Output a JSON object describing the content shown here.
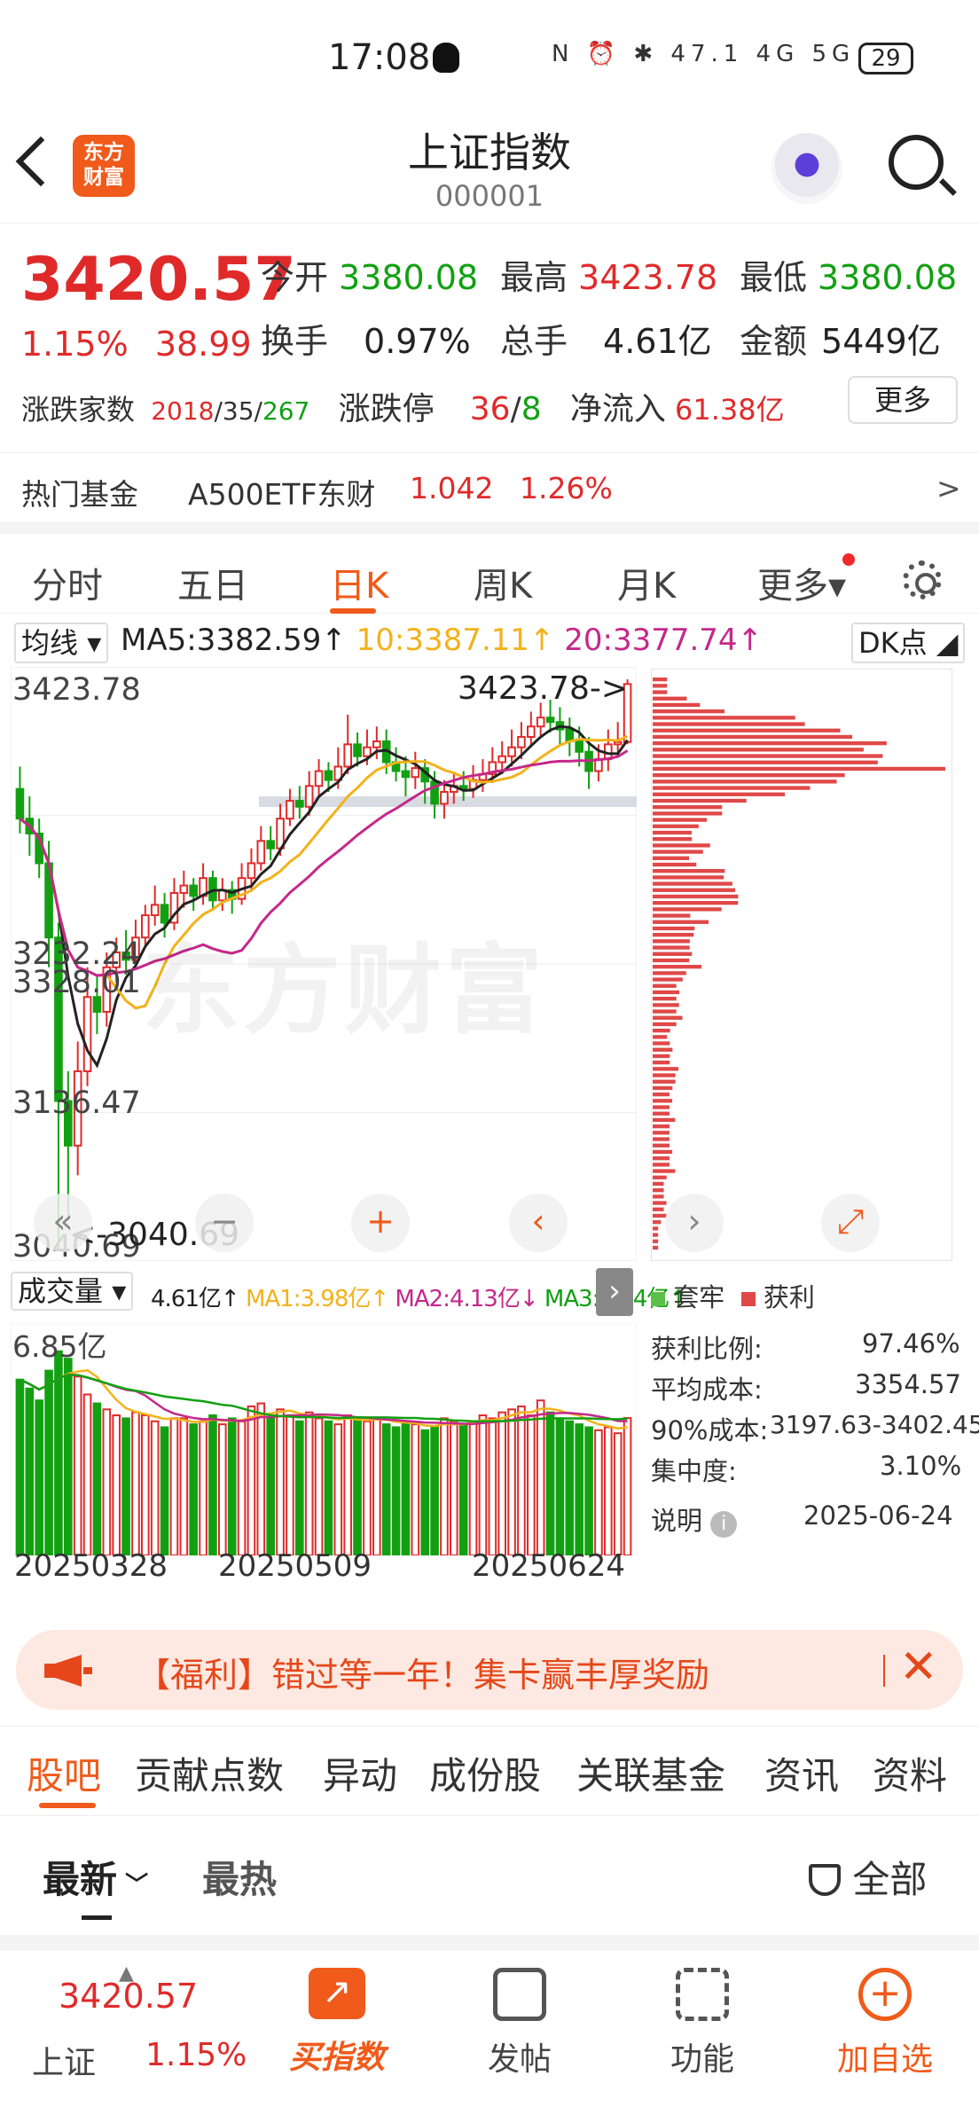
{
  "status": {
    "time": "17:08",
    "icons": "N ⏰ ✱ 47.1 4G 5G",
    "battery": "29"
  },
  "header": {
    "title": "上证指数",
    "code": "000001",
    "logo": "东方\n财富"
  },
  "quote": {
    "price": "3420.57",
    "change_pct": "1.15%",
    "change": "38.99",
    "open_label": "今开",
    "open": "3380.08",
    "high_label": "最高",
    "high": "3423.78",
    "low_label": "最低",
    "low": "3380.08",
    "turnover_label": "换手",
    "turnover": "0.97%",
    "volume_label": "总手",
    "volume": "4.61亿",
    "amount_label": "金额",
    "amount": "5449亿",
    "updown_label": "涨跌家数",
    "up": "2018",
    "flat": "35",
    "down": "267",
    "limit_label": "涨跌停",
    "limit_up": "36",
    "limit_down": "8",
    "inflow_label": "净流入",
    "inflow": "61.38亿",
    "more_label": "更多",
    "hot_fund_label": "热门基金",
    "hot_fund_name": "A500ETF东财",
    "hot_fund_price": "1.042",
    "hot_fund_pct": "1.26%",
    "hot_fund_arrow": ">"
  },
  "chart_tabs": [
    "分时",
    "五日",
    "日K",
    "周K",
    "月K",
    "更多▾"
  ],
  "chart": {
    "ma_selector": "均线",
    "ma5": "MA5:3382.59↑",
    "ma10": "10:3387.11↑",
    "ma20": "20:3377.74↑",
    "dk_label": "DK点",
    "price_labels": [
      "3423.78",
      "3328.01",
      "3232.24",
      "3136.47",
      "3040.69"
    ],
    "high_marker": "3423.78->",
    "low_marker": "<-3040.69",
    "watermark": "东方财富",
    "vol_selector": "成交量",
    "vol_value": "4.61亿↑",
    "vol_ma1": "MA1:3.98亿↑",
    "vol_ma2": "MA2:4.13亿↓",
    "vol_ma3": "MA3:4.04亿↑",
    "vol_max": "6.85亿",
    "dates": [
      "20250328",
      "20250509",
      "20250624"
    ],
    "colors": {
      "up": "#e02a2a",
      "down": "#12a012",
      "ma5": "#222222",
      "ma10": "#f2b21b",
      "ma20": "#c5288a"
    }
  },
  "cost": {
    "legend_locked": "套牢",
    "legend_profit": "获利",
    "profit_ratio_label": "获利比例:",
    "profit_ratio": "97.46%",
    "avg_cost_label": "平均成本:",
    "avg_cost": "3354.57",
    "cost90_label": "90%成本:",
    "cost90": "3197.63-3402.45",
    "concentration_label": "集中度:",
    "concentration": "3.10%",
    "note_label": "说明",
    "date": "2025-06-24"
  },
  "banner": {
    "text": "【福利】错过等一年！集卡赢丰厚奖励"
  },
  "bottom_tabs": [
    "股吧",
    "贡献点数",
    "异动",
    "成份股",
    "关联基金",
    "资讯",
    "资料"
  ],
  "sorts": {
    "latest": "最新",
    "hot": "最热",
    "filter": "全部"
  },
  "bottom_nav": {
    "index_price": "3420.57",
    "index_name": "上证",
    "index_pct": "1.15%",
    "buy": "买指数",
    "post": "发帖",
    "func": "功能",
    "add": "加自选"
  },
  "chart_data": {
    "type": "candlestick",
    "ylim": [
      3040.69,
      3423.78
    ],
    "xlabels": [
      "20250328",
      "20250509",
      "20250624"
    ],
    "candles": [
      [
        3350,
        3330,
        3365,
        3320
      ],
      [
        3330,
        3320,
        3345,
        3305
      ],
      [
        3320,
        3300,
        3330,
        3290
      ],
      [
        3300,
        3250,
        3315,
        3230
      ],
      [
        3250,
        3140,
        3260,
        3040.69
      ],
      [
        3140,
        3110,
        3160,
        3060
      ],
      [
        3110,
        3160,
        3180,
        3090
      ],
      [
        3160,
        3210,
        3230,
        3150
      ],
      [
        3210,
        3200,
        3225,
        3185
      ],
      [
        3200,
        3230,
        3240,
        3190
      ],
      [
        3230,
        3240,
        3250,
        3220
      ],
      [
        3240,
        3235,
        3255,
        3225
      ],
      [
        3235,
        3250,
        3262,
        3230
      ],
      [
        3250,
        3265,
        3272,
        3245
      ],
      [
        3265,
        3272,
        3285,
        3258
      ],
      [
        3272,
        3260,
        3280,
        3250
      ],
      [
        3260,
        3280,
        3290,
        3255
      ],
      [
        3280,
        3285,
        3295,
        3270
      ],
      [
        3285,
        3278,
        3290,
        3268
      ],
      [
        3278,
        3290,
        3300,
        3272
      ],
      [
        3290,
        3275,
        3295,
        3268
      ],
      [
        3275,
        3282,
        3290,
        3268
      ],
      [
        3282,
        3276,
        3288,
        3266
      ],
      [
        3276,
        3290,
        3300,
        3272
      ],
      [
        3290,
        3300,
        3310,
        3282
      ],
      [
        3300,
        3315,
        3325,
        3295
      ],
      [
        3315,
        3310,
        3325,
        3302
      ],
      [
        3310,
        3330,
        3340,
        3305
      ],
      [
        3330,
        3342,
        3350,
        3325
      ],
      [
        3342,
        3338,
        3352,
        3330
      ],
      [
        3338,
        3352,
        3362,
        3332
      ],
      [
        3352,
        3362,
        3370,
        3345
      ],
      [
        3362,
        3356,
        3368,
        3348
      ],
      [
        3356,
        3365,
        3378,
        3350
      ],
      [
        3365,
        3380,
        3400,
        3360
      ],
      [
        3380,
        3372,
        3388,
        3365
      ],
      [
        3372,
        3378,
        3390,
        3366
      ],
      [
        3378,
        3382,
        3392,
        3370
      ],
      [
        3382,
        3368,
        3390,
        3360
      ],
      [
        3368,
        3362,
        3378,
        3355
      ],
      [
        3362,
        3358,
        3372,
        3345
      ],
      [
        3358,
        3364,
        3375,
        3350
      ],
      [
        3364,
        3355,
        3370,
        3340
      ],
      [
        3355,
        3340,
        3362,
        3330
      ],
      [
        3340,
        3348,
        3356,
        3330
      ],
      [
        3348,
        3352,
        3360,
        3340
      ],
      [
        3352,
        3350,
        3362,
        3342
      ],
      [
        3350,
        3356,
        3366,
        3344
      ],
      [
        3356,
        3360,
        3370,
        3348
      ],
      [
        3360,
        3368,
        3378,
        3354
      ],
      [
        3368,
        3372,
        3382,
        3360
      ],
      [
        3372,
        3378,
        3390,
        3365
      ],
      [
        3378,
        3385,
        3395,
        3370
      ],
      [
        3385,
        3392,
        3402,
        3378
      ],
      [
        3392,
        3398,
        3408,
        3385
      ],
      [
        3398,
        3395,
        3410,
        3388
      ],
      [
        3395,
        3390,
        3405,
        3380
      ],
      [
        3390,
        3382,
        3398,
        3372
      ],
      [
        3382,
        3375,
        3392,
        3365
      ],
      [
        3375,
        3362,
        3385,
        3350
      ],
      [
        3362,
        3370,
        3380,
        3355
      ],
      [
        3370,
        3380,
        3390,
        3362
      ],
      [
        3380,
        3381.58,
        3395,
        3372
      ],
      [
        3381.58,
        3420.57,
        3423.78,
        3380.08
      ]
    ],
    "volumes": [
      5.9,
      5.6,
      5.2,
      6.2,
      6.85,
      6.6,
      6.0,
      5.4,
      5.1,
      4.9,
      4.7,
      4.6,
      4.8,
      4.7,
      4.5,
      4.3,
      4.6,
      4.6,
      4.4,
      4.5,
      4.7,
      4.4,
      4.6,
      4.5,
      5.0,
      5.1,
      4.6,
      4.9,
      4.7,
      4.5,
      4.8,
      4.6,
      4.5,
      4.4,
      4.7,
      4.6,
      4.5,
      4.6,
      4.4,
      4.3,
      4.5,
      4.4,
      4.2,
      4.3,
      4.6,
      4.5,
      4.4,
      4.5,
      4.7,
      4.6,
      4.8,
      4.9,
      5.0,
      4.7,
      5.2,
      4.8,
      4.6,
      4.5,
      4.4,
      4.3,
      4.2,
      4.3,
      4.1,
      4.61
    ]
  }
}
